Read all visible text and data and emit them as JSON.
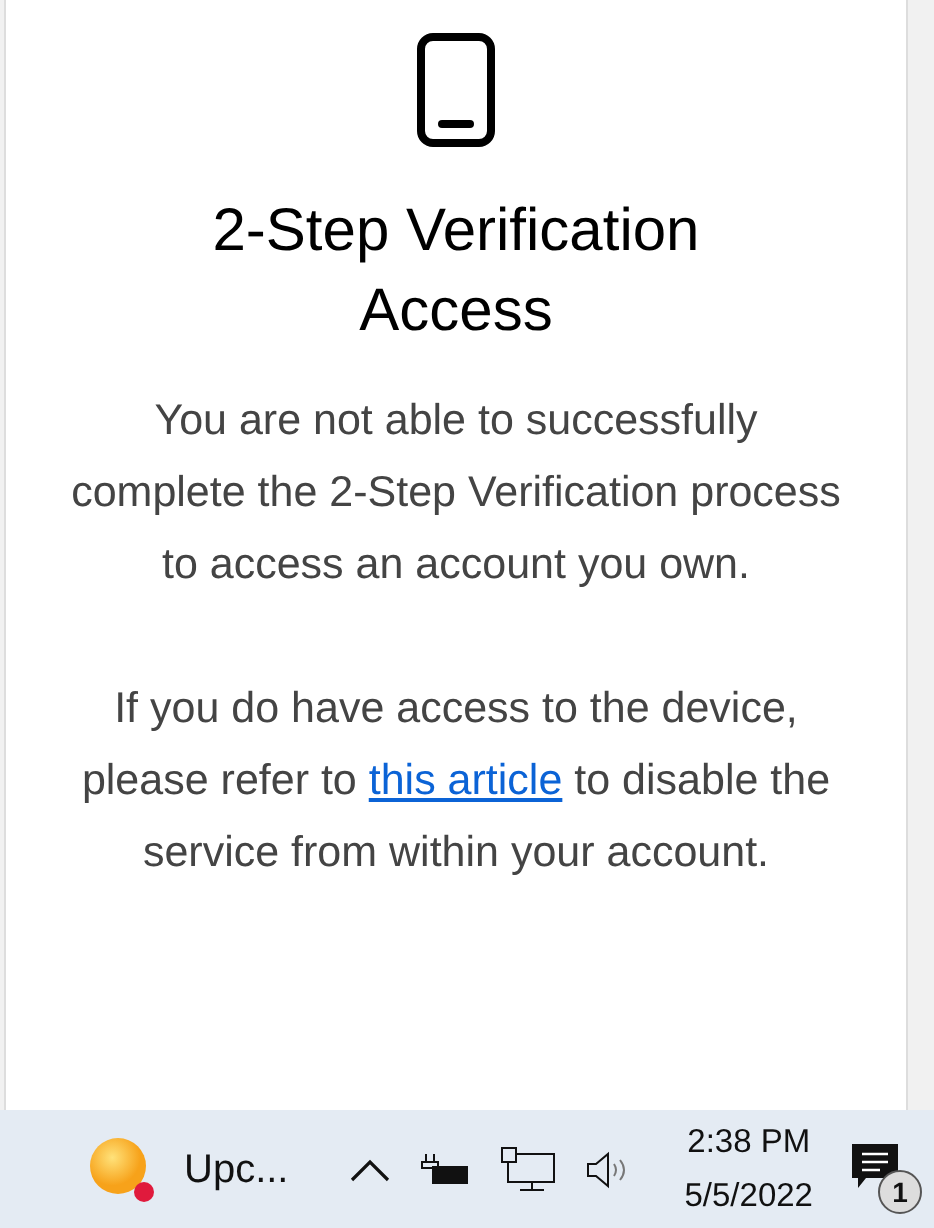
{
  "card": {
    "title": "2-Step Verification Access",
    "paragraphs": [
      {
        "text": "You are not able to successfully complete the 2-Step Verification process to access an account you own."
      },
      {
        "text": "If you do have access to the device, please refer to ",
        "link": "this article",
        "after": " to disable the service from within your account."
      }
    ]
  },
  "taskbar": {
    "app": {
      "label": "Upc...",
      "alert": true
    },
    "time": "2:38 PM",
    "date": "5/5/2022",
    "notifications": "1"
  }
}
